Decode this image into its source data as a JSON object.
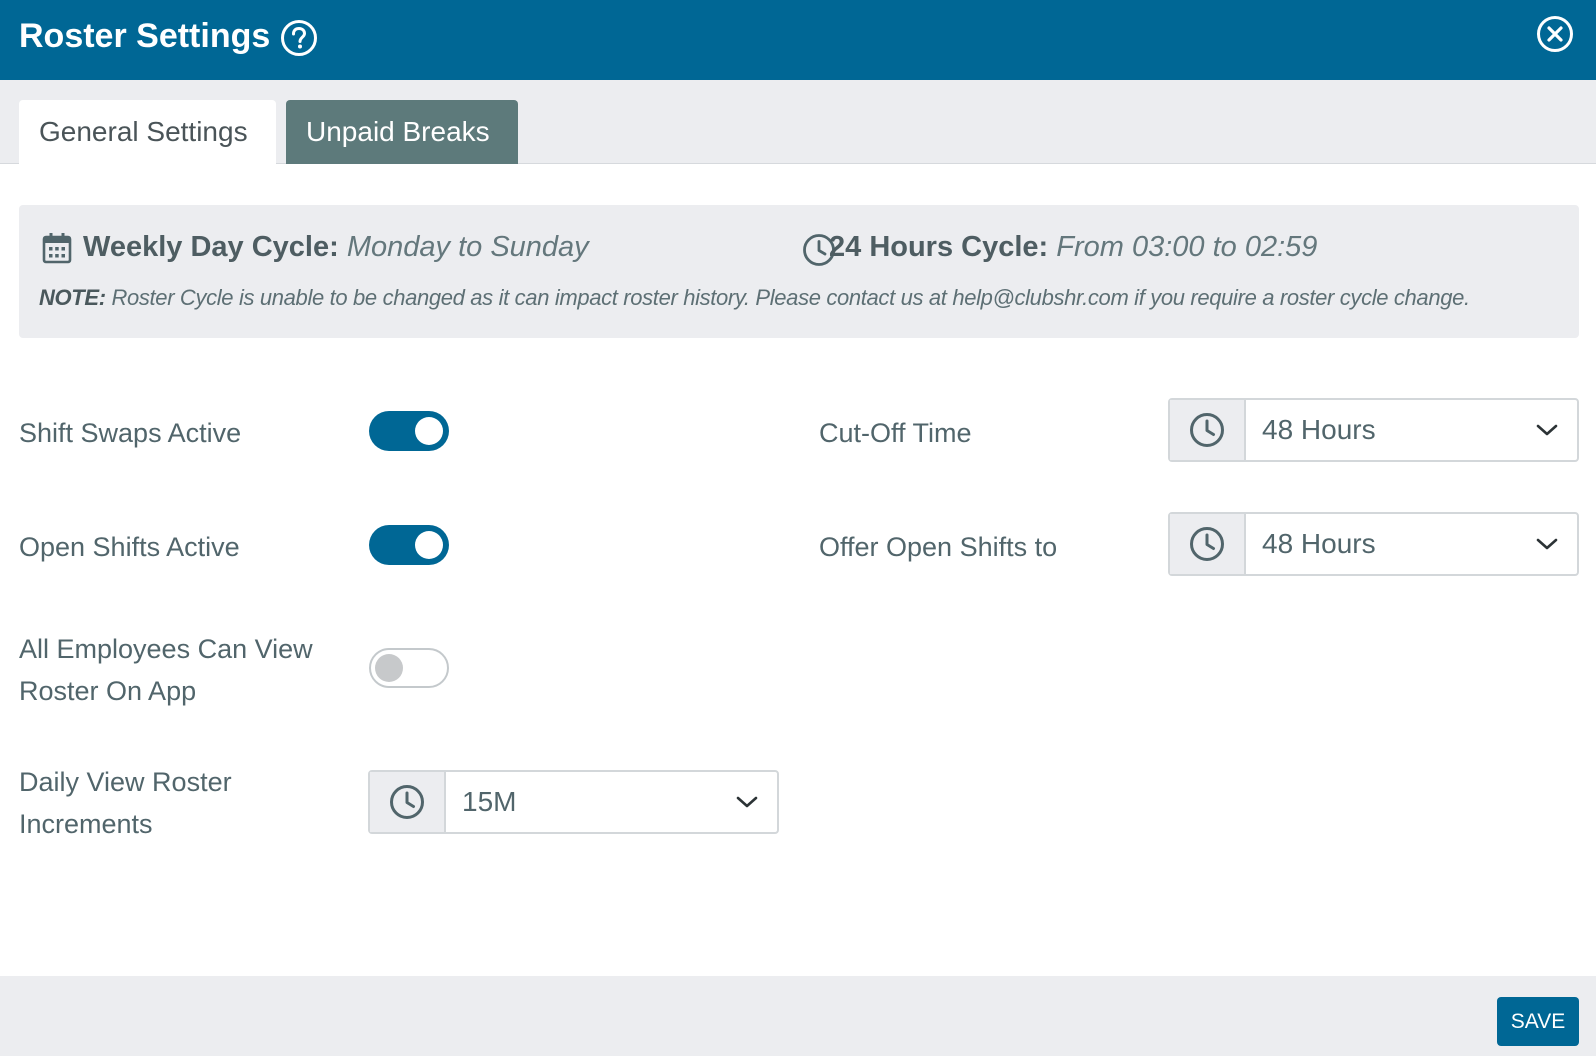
{
  "header": {
    "title": "Roster Settings",
    "help_icon": "question-circle-icon",
    "close_icon": "close-circle-icon"
  },
  "tabs": [
    {
      "label": "General Settings",
      "active": true
    },
    {
      "label": "Unpaid Breaks",
      "active": false
    }
  ],
  "cycle": {
    "weekly_label": "Weekly Day Cycle:",
    "weekly_value": "Monday to Sunday",
    "hours_label": "24 Hours Cycle:",
    "hours_value": "From 03:00 to 02:59",
    "note_label": "NOTE:",
    "note_text": "Roster Cycle is unable to be changed as it can impact roster history. Please contact us at help@clubshr.com if you require a roster cycle change."
  },
  "settings": {
    "shift_swaps": {
      "label": "Shift Swaps Active",
      "on": true
    },
    "open_shifts": {
      "label": "Open Shifts Active",
      "on": true
    },
    "view_roster": {
      "label_line1": "All Employees Can View",
      "label_line2": "Roster On App",
      "on": false
    },
    "increments": {
      "label_line1": "Daily View Roster",
      "label_line2": "Increments",
      "value": "15M"
    },
    "cutoff": {
      "label": "Cut-Off Time",
      "value": "48 Hours"
    },
    "offer": {
      "label": "Offer Open Shifts to",
      "value": "48 Hours"
    }
  },
  "footer": {
    "save_label": "SAVE"
  },
  "colors": {
    "primary": "#006795",
    "tab_inactive": "#5d7a7b",
    "panel_bg": "#ecedf0",
    "text": "#51656b"
  }
}
